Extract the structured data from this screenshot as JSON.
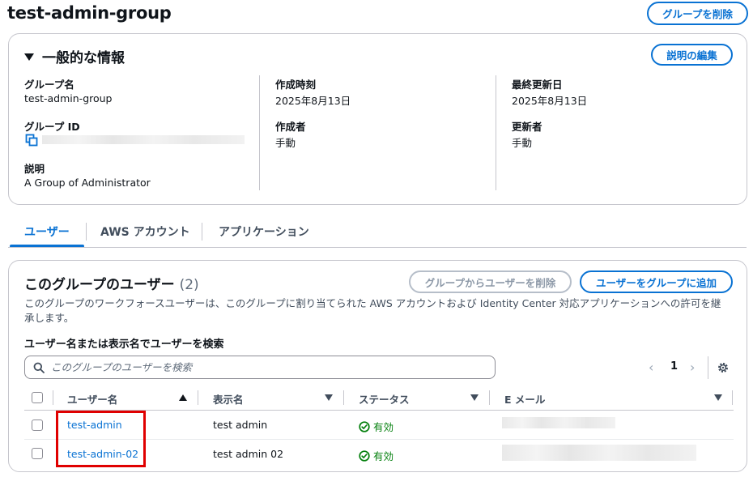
{
  "header": {
    "title": "test-admin-group",
    "delete_group_label": "グループを削除"
  },
  "general": {
    "title": "一般的な情報",
    "edit_description_label": "説明の編集",
    "group_name_label": "グループ名",
    "group_name_value": "test-admin-group",
    "group_id_label": "グループ ID",
    "description_label": "説明",
    "description_value": "A Group of Administrator",
    "created_time_label": "作成時刻",
    "created_time_value": "2025年8月13日",
    "created_by_label": "作成者",
    "created_by_value": "手動",
    "last_updated_label": "最終更新日",
    "last_updated_value": "2025年8月13日",
    "updated_by_label": "更新者",
    "updated_by_value": "手動"
  },
  "tabs": [
    {
      "label": "ユーザー",
      "active": true
    },
    {
      "label": "AWS アカウント",
      "active": false
    },
    {
      "label": "アプリケーション",
      "active": false
    }
  ],
  "users_section": {
    "title": "このグループのユーザー",
    "count": "(2)",
    "remove_button_label": "グループからユーザーを削除",
    "add_button_label": "ユーザーをグループに追加",
    "description": "このグループのワークフォースユーザーは、このグループに割り当てられた AWS アカウントおよび Identity Center 対応アプリケーションへの許可を継承します。",
    "search_label": "ユーザー名または表示名でユーザーを検索",
    "search_placeholder": "このグループのユーザーを検索",
    "current_page": "1"
  },
  "table": {
    "columns": [
      "ユーザー名",
      "表示名",
      "ステータス",
      "E メール"
    ],
    "rows": [
      {
        "username": "test-admin",
        "display_name": "test admin",
        "status": "有効"
      },
      {
        "username": "test-admin-02",
        "display_name": "test admin 02",
        "status": "有効"
      }
    ]
  },
  "colors": {
    "accent": "#0972d3",
    "success": "#037f0c",
    "highlight": "#e00000"
  }
}
